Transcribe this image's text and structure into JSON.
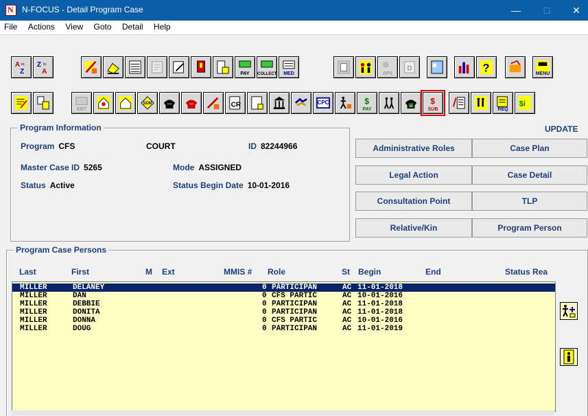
{
  "window": {
    "title": "N-FOCUS - Detail Program Case",
    "min": "—",
    "max": "□",
    "close": "✕"
  },
  "menu": [
    "File",
    "Actions",
    "View",
    "Goto",
    "Detail",
    "Help"
  ],
  "toolbar1_labels": {
    "pay": "PAY",
    "collect": "COLLECT",
    "med": "MED",
    "aps": "APS",
    "menu": "MENU"
  },
  "toolbar2_labels": {
    "ebt": "EBT",
    "sdm": "SDM",
    "cpc": "CPC",
    "pay": "PAY",
    "sub": "SUB",
    "req": "REQ"
  },
  "program_info": {
    "title": "Program Information",
    "update_label": "UPDATE",
    "program_label": "Program",
    "program_value": "CFS",
    "court": "COURT",
    "id_label": "ID",
    "id_value": "82244966",
    "master_case_label": "Master Case ID",
    "master_case_value": "5265",
    "mode_label": "Mode",
    "mode_value": "ASSIGNED",
    "status_label": "Status",
    "status_value": "Active",
    "status_begin_label": "Status Begin Date",
    "status_begin_value": "10-01-2016"
  },
  "buttons": {
    "admin_roles": "Administrative Roles",
    "case_plan": "Case Plan",
    "legal_action": "Legal Action",
    "case_detail": "Case Detail",
    "consultation_point": "Consultation Point",
    "tlp": "TLP",
    "relative_kin": "Relative/Kin",
    "program_person": "Program Person"
  },
  "persons": {
    "title": "Program Case Persons",
    "columns": [
      "Last",
      "First",
      "M",
      "Ext",
      "MMIS #",
      "Role",
      "St",
      "Begin",
      "End",
      "Status Rea"
    ],
    "rows": [
      {
        "last": "MILLER",
        "first": "DELANEY",
        "mmis": "0",
        "role": "PARTICIPAN",
        "st": "AC",
        "begin": "11-01-2018"
      },
      {
        "last": "MILLER",
        "first": "DAN",
        "mmis": "0",
        "role": "CFS PARTIC",
        "st": "AC",
        "begin": "10-01-2016"
      },
      {
        "last": "MILLER",
        "first": "DEBBIE",
        "mmis": "0",
        "role": "PARTICIPAN",
        "st": "AC",
        "begin": "11-01-2018"
      },
      {
        "last": "MILLER",
        "first": "DONITA",
        "mmis": "0",
        "role": "PARTICIPAN",
        "st": "AC",
        "begin": "11-01-2018"
      },
      {
        "last": "MILLER",
        "first": "DONNA",
        "mmis": "0",
        "role": "CFS PARTIC",
        "st": "AC",
        "begin": "10-01-2016"
      },
      {
        "last": "MILLER",
        "first": "DOUG",
        "mmis": "0",
        "role": "PARTICIPAN",
        "st": "AC",
        "begin": "11-01-2019"
      }
    ]
  },
  "colors": {
    "title_bar": "#0a5fa8",
    "label_blue": "#1f3f7a",
    "list_bg": "#ffffc4",
    "selection": "#0a246a",
    "highlight": "#e00000"
  }
}
